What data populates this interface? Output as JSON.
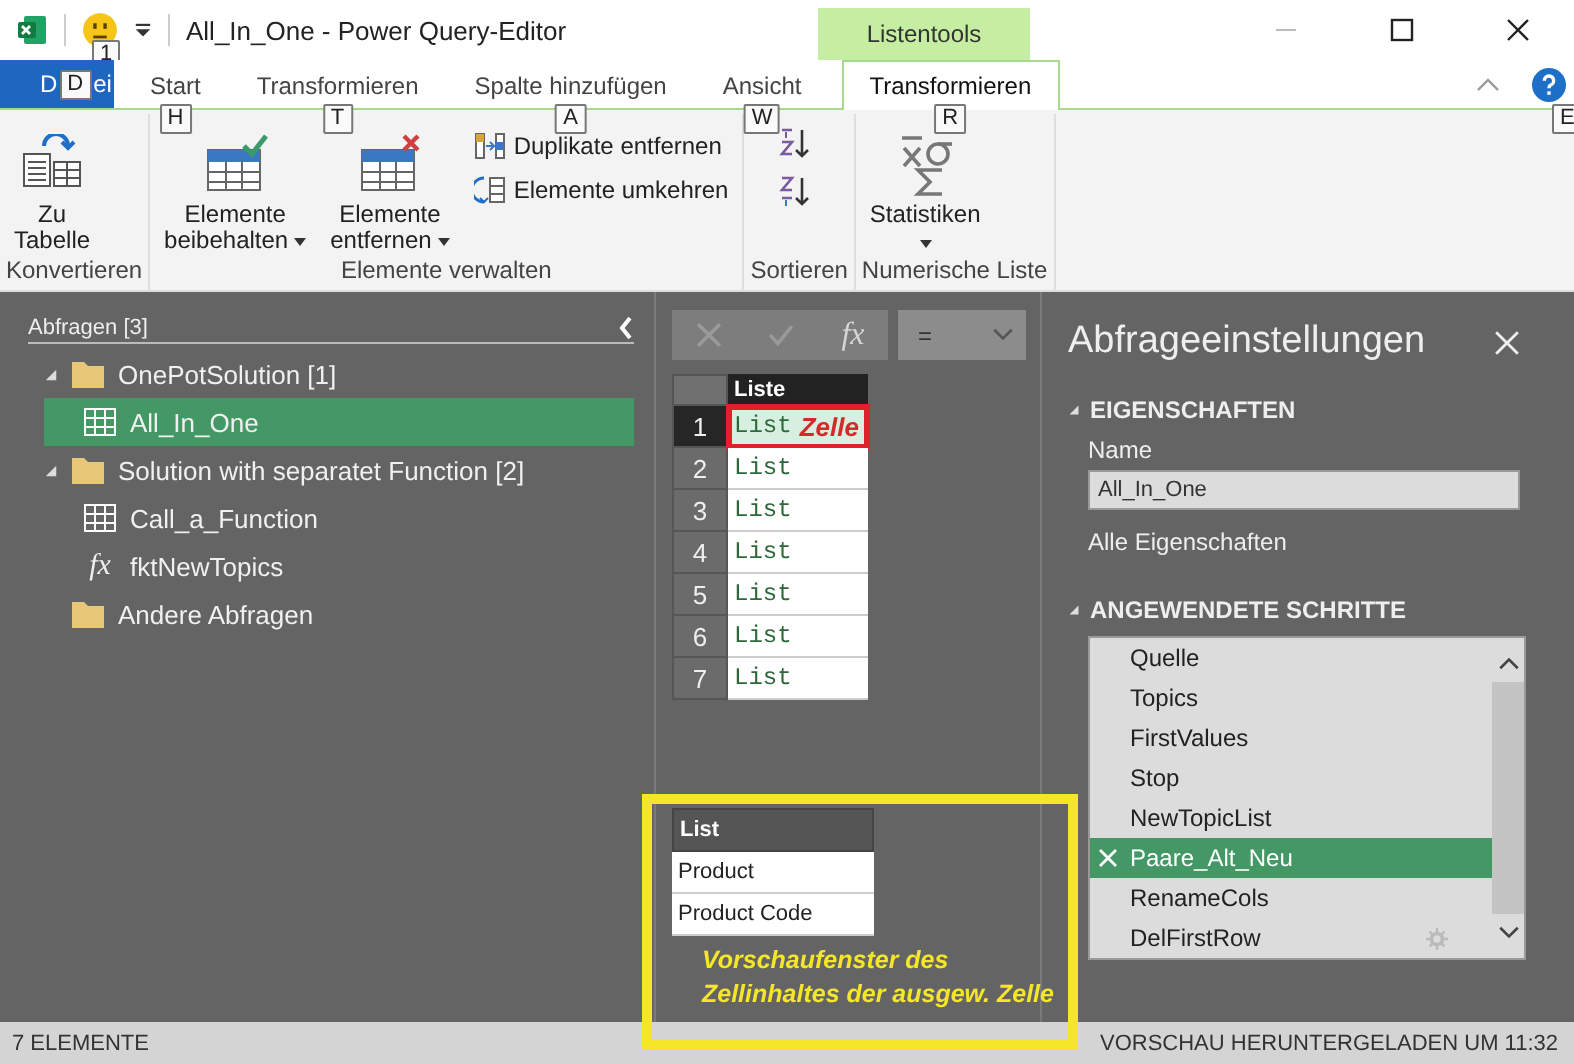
{
  "title_bar": {
    "title": "All_In_One - Power Query-Editor",
    "quick_access_keytip": "1",
    "context_group": "Listentools"
  },
  "ribbon_tabs": [
    {
      "kind": "file",
      "label_parts": [
        "D",
        "ei"
      ],
      "keytip": "D",
      "selected": false
    },
    {
      "kind": "tab",
      "label": "Start",
      "keytip": "H",
      "selected": false
    },
    {
      "kind": "tab",
      "label": "Transformieren",
      "keytip": "T",
      "selected": false
    },
    {
      "kind": "tab",
      "label": "Spalte hinzufügen",
      "keytip": "A",
      "selected": false
    },
    {
      "kind": "tab",
      "label": "Ansicht",
      "keytip": "W",
      "selected": false
    },
    {
      "kind": "tab",
      "label": "Transformieren",
      "keytip": "R",
      "selected": true
    }
  ],
  "help_keytip": "E",
  "ribbon_groups": [
    {
      "label": "Konvertieren",
      "items": [
        {
          "kind": "large",
          "lines": [
            "Zu",
            "Tabelle"
          ],
          "dropdown": false
        }
      ]
    },
    {
      "label": "Elemente verwalten",
      "items": [
        {
          "kind": "large",
          "lines": [
            "Elemente",
            "beibehalten"
          ],
          "dropdown": true
        },
        {
          "kind": "large",
          "lines": [
            "Elemente",
            "entfernen"
          ],
          "dropdown": true
        },
        {
          "kind": "small-stack",
          "entries": [
            "Duplikate entfernen",
            "Elemente umkehren"
          ]
        }
      ]
    },
    {
      "label": "Sortieren",
      "items": [
        {
          "kind": "icon-stack"
        }
      ]
    },
    {
      "label": "Numerische Liste",
      "items": [
        {
          "kind": "large",
          "lines": [
            "Statistiken"
          ],
          "dropdown": true
        }
      ]
    }
  ],
  "queries": {
    "title": "Abfragen [3]",
    "items": [
      {
        "kind": "folder",
        "label": "OnePotSolution [1]",
        "expanded": true,
        "children": [
          {
            "kind": "table",
            "label": "All_In_One",
            "selected": true
          }
        ]
      },
      {
        "kind": "folder",
        "label": "Solution with separatet Function [2]",
        "expanded": true,
        "children": [
          {
            "kind": "table",
            "label": "Call_a_Function",
            "selected": false
          },
          {
            "kind": "function",
            "glyph": "fx",
            "label": "fktNewTopics",
            "selected": false
          }
        ]
      },
      {
        "kind": "folder",
        "label": "Andere Abfragen"
      }
    ]
  },
  "formula_bar": {
    "glyph": "fx",
    "operator": "="
  },
  "grid": {
    "column": "Liste",
    "rows": [
      {
        "number": "1",
        "value": "List",
        "selected": true
      },
      {
        "number": "2",
        "value": "List",
        "selected": false
      },
      {
        "number": "3",
        "value": "List",
        "selected": false
      },
      {
        "number": "4",
        "value": "List",
        "selected": false
      },
      {
        "number": "5",
        "value": "List",
        "selected": false
      },
      {
        "number": "6",
        "value": "List",
        "selected": false
      },
      {
        "number": "7",
        "value": "List",
        "selected": false
      }
    ]
  },
  "cell_callout": "Zelle",
  "preview": {
    "column": "List",
    "rows": [
      "Product",
      "Product Code"
    ]
  },
  "preview_callout": [
    "Vorschaufenster des",
    "Zellinhaltes der ausgew. Zelle"
  ],
  "settings": {
    "title": "Abfrageeinstellungen",
    "properties_header": "EIGENSCHAFTEN",
    "name_label": "Name",
    "name_value": "All_In_One",
    "all_properties": "Alle Eigenschaften",
    "steps_header": "ANGEWENDETE SCHRITTE",
    "steps": [
      {
        "label": "Quelle",
        "selected": false,
        "settings": false
      },
      {
        "label": "Topics",
        "selected": false,
        "settings": false
      },
      {
        "label": "FirstValues",
        "selected": false,
        "settings": false
      },
      {
        "label": "Stop",
        "selected": false,
        "settings": false
      },
      {
        "label": "NewTopicList",
        "selected": false,
        "settings": false
      },
      {
        "label": "Paare_Alt_Neu",
        "selected": true,
        "settings": false
      },
      {
        "label": "RenameCols",
        "selected": false,
        "settings": false
      },
      {
        "label": "DelFirstRow",
        "selected": false,
        "settings": true
      }
    ]
  },
  "status_bar": {
    "left": "7 ELEMENTE",
    "right": "VORSCHAU HERUNTERGELADEN UM 11:32"
  }
}
